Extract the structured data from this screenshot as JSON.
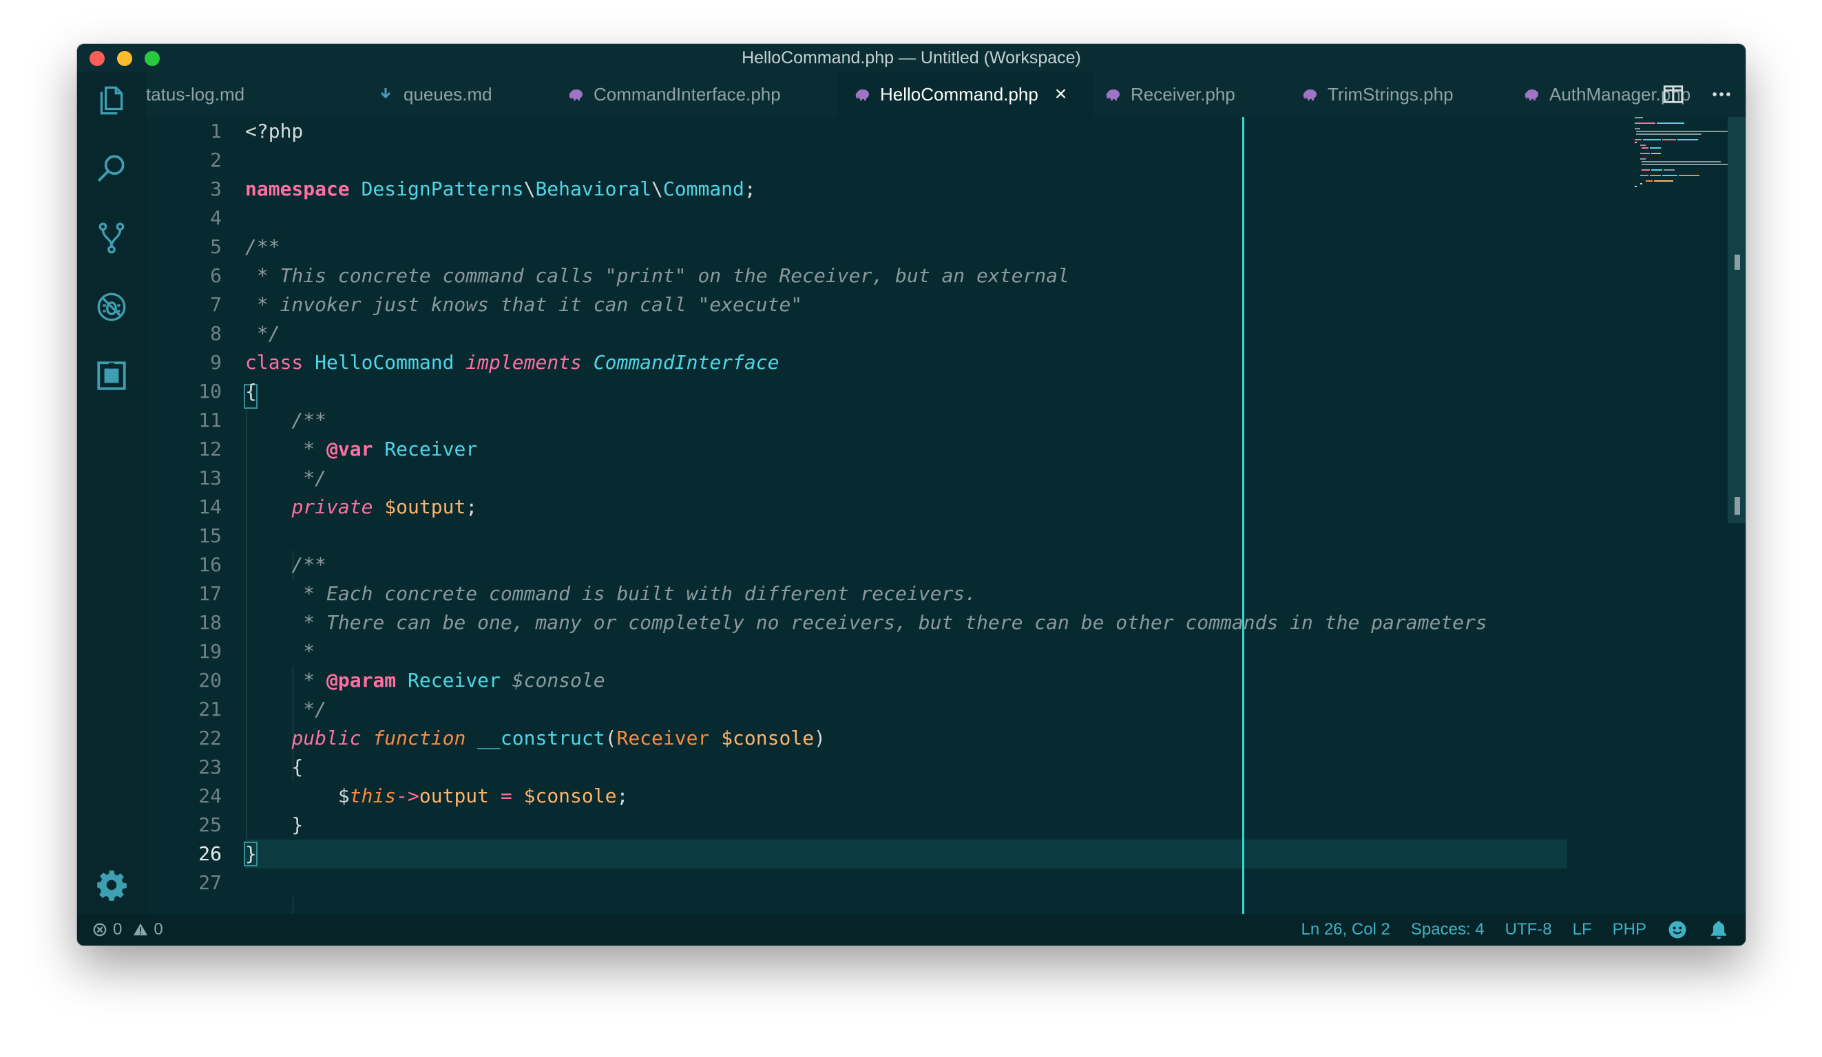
{
  "window": {
    "title": "HelloCommand.php — Untitled (Workspace)"
  },
  "tabs": [
    {
      "label": "tatus-log.md",
      "icon": "markdown-icon"
    },
    {
      "label": "queues.md",
      "icon": "markdown-icon"
    },
    {
      "label": "CommandInterface.php",
      "icon": "php-elephant-icon"
    },
    {
      "label": "HelloCommand.php",
      "icon": "php-elephant-icon",
      "active": true
    },
    {
      "label": "Receiver.php",
      "icon": "php-elephant-icon"
    },
    {
      "label": "TrimStrings.php",
      "icon": "php-elephant-icon"
    },
    {
      "label": "AuthManager.php",
      "icon": "php-elephant-icon"
    }
  ],
  "tab_close_glyph": "×",
  "activity_bar": [
    "explorer-icon",
    "search-icon",
    "source-control-icon",
    "debug-icon",
    "extensions-icon",
    "settings-gear-icon"
  ],
  "editor": {
    "current_line": 26,
    "line_numbers": [
      "1",
      "2",
      "3",
      "4",
      "5",
      "6",
      "7",
      "8",
      "9",
      "10",
      "11",
      "12",
      "13",
      "14",
      "15",
      "16",
      "17",
      "18",
      "19",
      "20",
      "21",
      "22",
      "23",
      "24",
      "25",
      "26",
      "27"
    ],
    "lines": [
      [
        {
          "t": "<?php",
          "c": ""
        }
      ],
      [],
      [
        {
          "t": "namespace",
          "c": "kb"
        },
        {
          "t": " ",
          "c": ""
        },
        {
          "t": "DesignPatterns",
          "c": "t"
        },
        {
          "t": "\\",
          "c": ""
        },
        {
          "t": "Behavioral",
          "c": "t"
        },
        {
          "t": "\\",
          "c": ""
        },
        {
          "t": "Command",
          "c": "t"
        },
        {
          "t": ";",
          "c": ""
        }
      ],
      [],
      [
        {
          "t": "/**",
          "c": "c"
        }
      ],
      [
        {
          "t": " * This concrete command calls \"print\" on the Receiver, but an external",
          "c": "c"
        }
      ],
      [
        {
          "t": " * invoker just knows that it can call \"execute\"",
          "c": "c"
        }
      ],
      [
        {
          "t": " */",
          "c": "c"
        }
      ],
      [
        {
          "t": "class",
          "c": "k"
        },
        {
          "t": " ",
          "c": ""
        },
        {
          "t": "HelloCommand",
          "c": "t"
        },
        {
          "t": " ",
          "c": ""
        },
        {
          "t": "implements",
          "c": "ki"
        },
        {
          "t": " ",
          "c": ""
        },
        {
          "t": "CommandInterface",
          "c": "ti"
        }
      ],
      [
        {
          "t": "{",
          "c": ""
        }
      ],
      [
        {
          "t": "    /**",
          "c": "c"
        }
      ],
      [
        {
          "t": "     * ",
          "c": "c"
        },
        {
          "t": "@var",
          "c": "kb"
        },
        {
          "t": " ",
          "c": ""
        },
        {
          "t": "Receiver",
          "c": "t"
        }
      ],
      [
        {
          "t": "     */",
          "c": "c"
        }
      ],
      [
        {
          "t": "    ",
          "c": ""
        },
        {
          "t": "private",
          "c": "ki"
        },
        {
          "t": " ",
          "c": ""
        },
        {
          "t": "$output",
          "c": "v"
        },
        {
          "t": ";",
          "c": ""
        }
      ],
      [],
      [
        {
          "t": "    /**",
          "c": "c"
        }
      ],
      [
        {
          "t": "     * Each concrete command is built with different receivers.",
          "c": "c"
        }
      ],
      [
        {
          "t": "     * There can be one, many or completely no receivers, but there can be other commands in the parameters",
          "c": "c"
        }
      ],
      [
        {
          "t": "     *",
          "c": "c"
        }
      ],
      [
        {
          "t": "     * ",
          "c": "c"
        },
        {
          "t": "@param",
          "c": "kb"
        },
        {
          "t": " ",
          "c": ""
        },
        {
          "t": "Receiver",
          "c": "t"
        },
        {
          "t": " ",
          "c": ""
        },
        {
          "t": "$console",
          "c": "vc"
        }
      ],
      [
        {
          "t": "     */",
          "c": "c"
        }
      ],
      [
        {
          "t": "    ",
          "c": ""
        },
        {
          "t": "public",
          "c": "ki"
        },
        {
          "t": " ",
          "c": ""
        },
        {
          "t": "function",
          "c": "st"
        },
        {
          "t": " ",
          "c": ""
        },
        {
          "t": "__construct",
          "c": "f"
        },
        {
          "t": "(",
          "c": ""
        },
        {
          "t": "Receiver",
          "c": "cl"
        },
        {
          "t": " ",
          "c": ""
        },
        {
          "t": "$console",
          "c": "v"
        },
        {
          "t": ")",
          "c": ""
        }
      ],
      [
        {
          "t": "    {",
          "c": ""
        }
      ],
      [
        {
          "t": "        $",
          "c": ""
        },
        {
          "t": "this",
          "c": "st"
        },
        {
          "t": "->",
          "c": "op"
        },
        {
          "t": "output",
          "c": "v"
        },
        {
          "t": " ",
          "c": ""
        },
        {
          "t": "=",
          "c": "op"
        },
        {
          "t": " ",
          "c": ""
        },
        {
          "t": "$console",
          "c": "v"
        },
        {
          "t": ";",
          "c": ""
        }
      ],
      [
        {
          "t": "    }",
          "c": ""
        }
      ],
      [
        {
          "t": "}",
          "c": ""
        }
      ],
      []
    ]
  },
  "status": {
    "errors": "0",
    "warnings": "0",
    "position": "Ln 26, Col 2",
    "spaces": "Spaces: 4",
    "encoding": "UTF-8",
    "eol": "LF",
    "language": "PHP"
  }
}
